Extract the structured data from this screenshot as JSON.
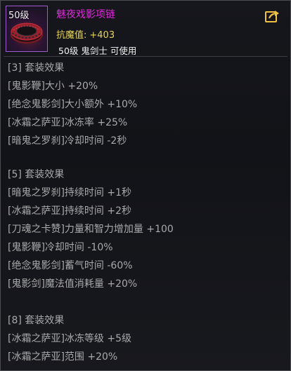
{
  "item": {
    "level_badge": "50级",
    "name": "魅夜戏影项链",
    "stat_label": "抗魔值:",
    "stat_value": "+403",
    "requirement": "50级 鬼剑士 可使用"
  },
  "colors": {
    "item_name": "#dd2bd8",
    "stat": "#e7d45e",
    "set_text": "#a9a9ab",
    "icon_border": "#9f5bd1"
  },
  "icons": {
    "item": "necklace-icon",
    "share": "share-icon"
  },
  "sets": [
    {
      "title": "[3] 套装效果",
      "effects": [
        "[鬼影鞭]大小 +20%",
        "[绝念鬼影剑]大小额外 +10%",
        "[冰霜之萨亚]冰冻率 +25%",
        "[暗鬼之罗刹]冷却时间 -2秒"
      ]
    },
    {
      "title": "[5] 套装效果",
      "effects": [
        "[暗鬼之罗刹]持续时间 +1秒",
        "[冰霜之萨亚]持续时间 +2秒",
        "[刀魂之卡赞]力量和智力增加量 +100",
        "[鬼影鞭]冷却时间 -10%",
        "[绝念鬼影剑]蓄气时间 -60%",
        "[鬼影剑]魔法值消耗量 +20%"
      ]
    },
    {
      "title": "[8] 套装效果",
      "effects": [
        "[冰霜之萨亚]冰冻等级 +5级",
        "[冰霜之萨亚]范围 +20%"
      ]
    }
  ]
}
